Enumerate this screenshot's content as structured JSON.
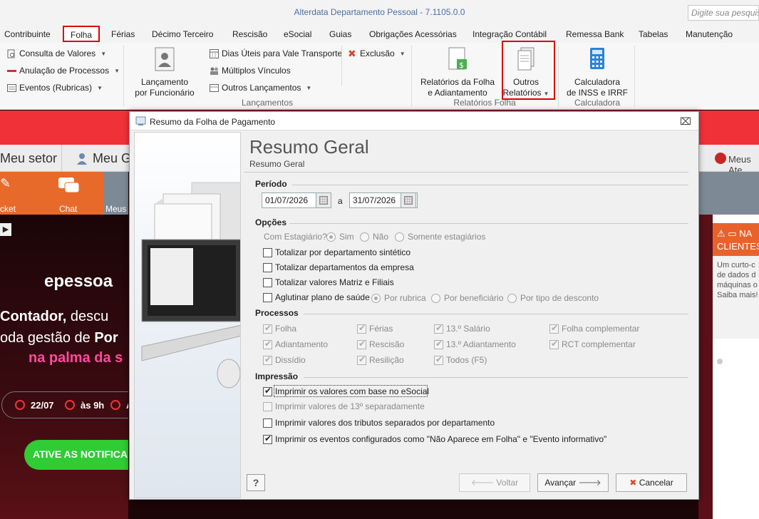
{
  "app": {
    "title": "Alterdata Departamento Pessoal - 7.1105.0.0",
    "search_placeholder": "Digite sua pesquisa"
  },
  "menu": [
    "Contribuinte",
    "Folha",
    "Férias",
    "Décimo Terceiro",
    "Rescisão",
    "eSocial",
    "Guias",
    "Obrigações Acessórias",
    "Integração Contábil",
    "Remessa Bank",
    "Tabelas",
    "Manutenção"
  ],
  "ribbon": {
    "consultas": {
      "consulta": "Consulta de Valores",
      "anulacao": "Anulação de Processos",
      "eventos": "Eventos (Rubricas)"
    },
    "lancamentos": {
      "lancamento_func": [
        "Lançamento",
        "por Funcionário"
      ],
      "dias_uteis": "Dias Úteis para Vale Transporte",
      "multiplos": "Múltiplos Vínculos",
      "outros": "Outros Lançamentos",
      "exclusao": "Exclusão",
      "group": "Lançamentos"
    },
    "relatorios": {
      "folha_adiant": [
        "Relatórios da Folha",
        "e Adiantamento"
      ],
      "outros": [
        "Outros",
        "Relatórios"
      ],
      "group": "Relatórios Folha"
    },
    "calculadora": {
      "btn": [
        "Calculadora",
        "de INSS e IRRF"
      ],
      "group": "Calculadora"
    }
  },
  "background": {
    "meu_setor": "Meu setor",
    "meu_ge": "Meu Ge",
    "meus_ate": "Meus Ate",
    "tiles": [
      "cket",
      "Chat",
      "Meus"
    ],
    "promo": {
      "logo": "epessoa",
      "line1_bold": "Contador,",
      "line1_rest": " descu",
      "line2_pre": "oda gestão de ",
      "line2_bold": "Por",
      "line3": "na palma da s",
      "date": "22/07",
      "time": "às 9h",
      "extra": "A",
      "cta": "ATIVE AS NOTIFICA"
    },
    "notif": {
      "head1": "NA",
      "head2": "CLIENTES",
      "body": [
        "Um curto-c",
        "de dados d",
        "máquinas o",
        "Saiba mais!"
      ]
    }
  },
  "dialog": {
    "title": "Resumo da Folha de Pagamento",
    "heading": "Resumo Geral",
    "subheading": "Resumo Geral",
    "periodo": {
      "label": "Período",
      "start": "01/07/2026",
      "sep": "a",
      "end": "31/07/2026"
    },
    "opcoes": {
      "label": "Opções",
      "estagiario_label": "Com Estagiário?",
      "estagiario_options": [
        "Sim",
        "Não",
        "Somente estagiários"
      ],
      "totalizar_depto_sintetico": "Totalizar por departamento sintético",
      "totalizar_depto_empresa": "Totalizar departamentos da empresa",
      "totalizar_matriz": "Totalizar valores Matriz e Filiais",
      "aglutinar": "Aglutinar plano de saúde",
      "aglutinar_options": [
        "Por rubrica",
        "Por beneficiário",
        "Por tipo de desconto"
      ]
    },
    "processos": {
      "label": "Processos",
      "items": [
        "Folha",
        "Férias",
        "13.º Salário",
        "Folha complementar",
        "Adiantamento",
        "Rescisão",
        "13.º Adiantamento",
        "RCT complementar",
        "Dissídio",
        "Resilição",
        "Todos (F5)"
      ]
    },
    "impressao": {
      "label": "Impressão",
      "esocial": "Imprimir os valores com base no eSocial",
      "decimo": "Imprimir valores de 13º separadamente",
      "tributos": "Imprimir valores dos tributos separados por departamento",
      "eventos": "Imprimir os eventos configurados como \"Não Aparece em Folha\" e \"Evento informativo\""
    },
    "buttons": {
      "help": "?",
      "voltar": "Voltar",
      "avancar": "Avançar",
      "cancelar": "Cancelar"
    }
  },
  "colors": {
    "accent_red": "#e00000",
    "band_red": "#f03238",
    "cta_green": "#2fcc34",
    "orange": "#e86a2b"
  }
}
